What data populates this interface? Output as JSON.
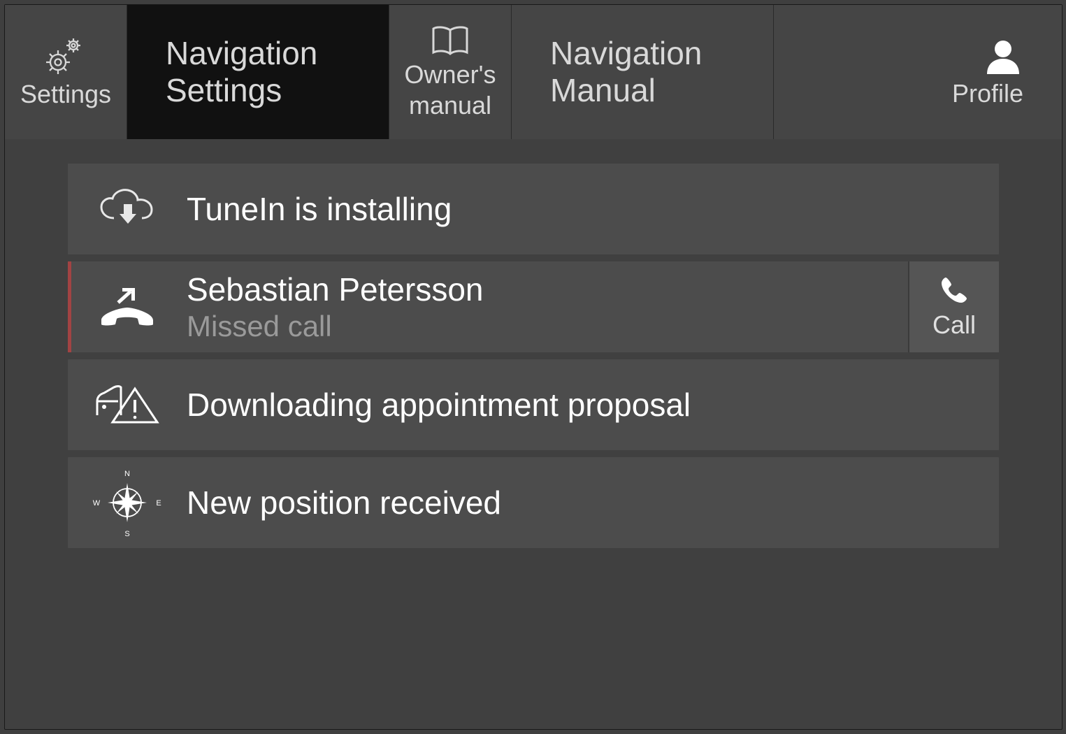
{
  "tabs": {
    "settings_label": "Settings",
    "nav_settings_line1": "Navigation",
    "nav_settings_line2": "Settings",
    "owner_line1": "Owner's",
    "owner_line2": "manual",
    "nav_manual_line1": "Navigation",
    "nav_manual_line2": "Manual",
    "profile_label": "Profile"
  },
  "rows": {
    "installing": {
      "title": "TuneIn is installing"
    },
    "missed": {
      "title": "Sebastian Petersson",
      "subtitle": "Missed call",
      "action": "Call"
    },
    "appointment": {
      "title": "Downloading appointment proposal"
    },
    "position": {
      "title": "New position received"
    }
  }
}
